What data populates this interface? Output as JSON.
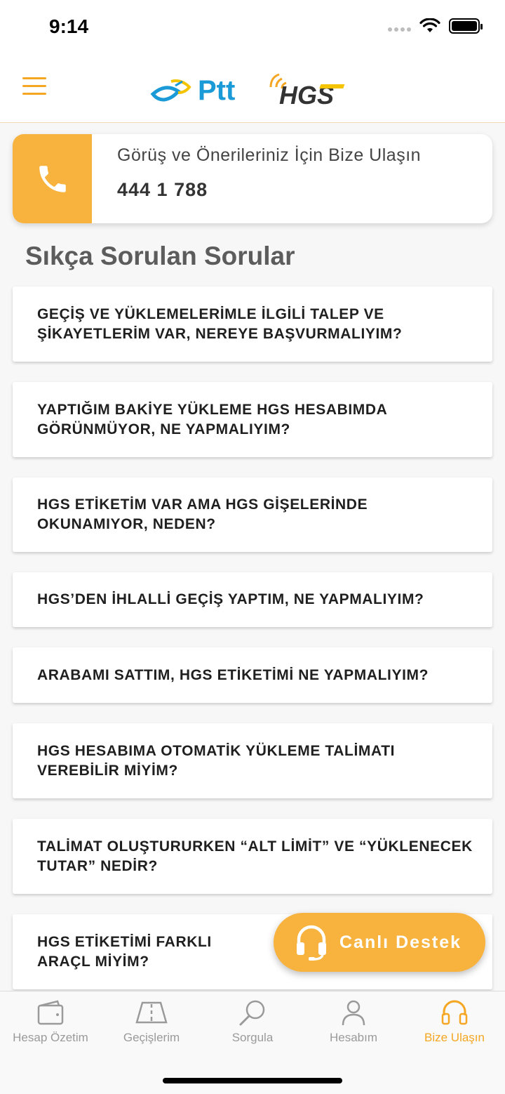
{
  "status": {
    "time": "9:14"
  },
  "header": {
    "ptt_logo_text": "Ptt",
    "hgs_logo_text": "HGS"
  },
  "contact": {
    "title": "Görüş ve Önerileriniz İçin Bize Ulaşın",
    "phone": "444 1 788",
    "icon": "phone-icon"
  },
  "faq": {
    "title": "Sıkça Sorulan Sorular",
    "items": [
      "GEÇİŞ VE YÜKLEMELERİMLE İLGİLİ TALEP VE ŞİKAYETLERİM VAR, NEREYE BAŞVURMALIYIM?",
      "YAPTIĞIM BAKİYE YÜKLEME HGS HESABIMDA GÖRÜNMÜYOR, NE YAPMALIYIM?",
      "HGS ETİKETİM VAR AMA HGS GİŞELERİNDE OKUNAMIYOR, NEDEN?",
      "HGS’DEN İHLALLİ GEÇİŞ YAPTIM, NE YAPMALIYIM?",
      "ARABAMI SATTIM, HGS ETİKETİMİ NE YAPMALIYIM?",
      "HGS HESABIMA OTOMATİK YÜKLEME TALİMATI VEREBİLİR MİYİM?",
      "TALİMAT OLUŞTURURKEN “ALT LİMİT” VE “YÜKLENECEK TUTAR” NEDİR?",
      "HGS ETİKETİMİ FARKLI ARAÇL MİYİM?"
    ]
  },
  "live_support": {
    "label": "Canlı Destek",
    "icon": "headset-icon"
  },
  "tabs": [
    {
      "label": "Hesap Özetim",
      "icon": "wallet-icon"
    },
    {
      "label": "Geçişlerim",
      "icon": "road-icon"
    },
    {
      "label": "Sorgula",
      "icon": "search-icon"
    },
    {
      "label": "Hesabım",
      "icon": "user-icon"
    },
    {
      "label": "Bize Ulaşın",
      "icon": "headset-icon",
      "active": true
    }
  ],
  "colors": {
    "accent": "#f7b33d",
    "ptt_blue": "#1a9ad6",
    "tab_inactive": "#9a9a9a"
  }
}
